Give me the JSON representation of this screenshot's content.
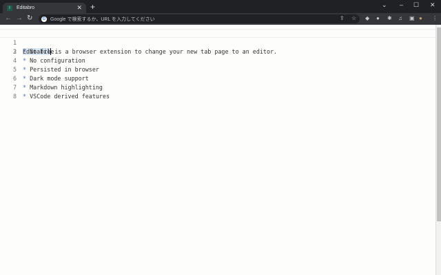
{
  "browser": {
    "tab_title": "Editabro",
    "new_tab": "+",
    "close": "✕",
    "omnibox_placeholder": "Google で検索するか、URL を入力してください"
  },
  "editor": {
    "lines": [
      {
        "num": "1",
        "selected": "Editabro",
        "text": " is a browser extension to change your new tab page to an editor."
      },
      {
        "num": "2",
        "text": ""
      },
      {
        "num": "3",
        "bullet": "*",
        "text": " No file"
      },
      {
        "num": "4",
        "bullet": "*",
        "text": " No configuration"
      },
      {
        "num": "5",
        "bullet": "*",
        "text": " Persisted in browser"
      },
      {
        "num": "6",
        "bullet": "*",
        "text": " Dark mode support"
      },
      {
        "num": "7",
        "bullet": "*",
        "text": " Markdown highlighting"
      },
      {
        "num": "8",
        "bullet": "*",
        "text": " VSCode derived features"
      }
    ]
  }
}
